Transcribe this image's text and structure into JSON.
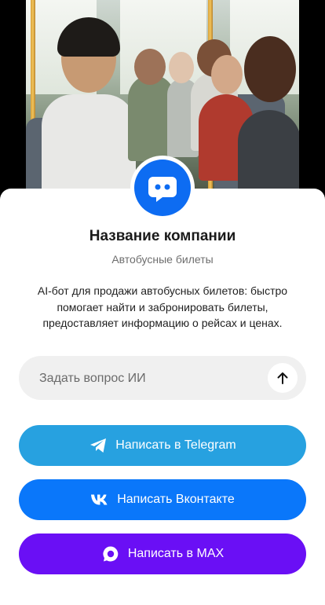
{
  "hero": {
    "icon": "hero-photo"
  },
  "company": {
    "name": "Название компании",
    "subtitle": "Автобусные билеты",
    "description": "AI-бот для продажи автобусных билетов: быстро помогает найти и забронировать билеты, предоставляет информацию о рейсах и ценах.",
    "avatar_icon": "chat-bot-icon",
    "avatar_color": "#0d6cf2"
  },
  "ask": {
    "placeholder": "Задать вопрос ИИ",
    "send_icon": "arrow-up-icon"
  },
  "buttons": [
    {
      "label": "Написать в Telegram",
      "icon": "telegram-icon",
      "color": "#27a1e0"
    },
    {
      "label": "Написать Вконтакте",
      "icon": "vk-icon",
      "color": "#0a77fa"
    },
    {
      "label": "Написать в MAX",
      "icon": "max-icon",
      "color": "#6a0ff5"
    }
  ]
}
